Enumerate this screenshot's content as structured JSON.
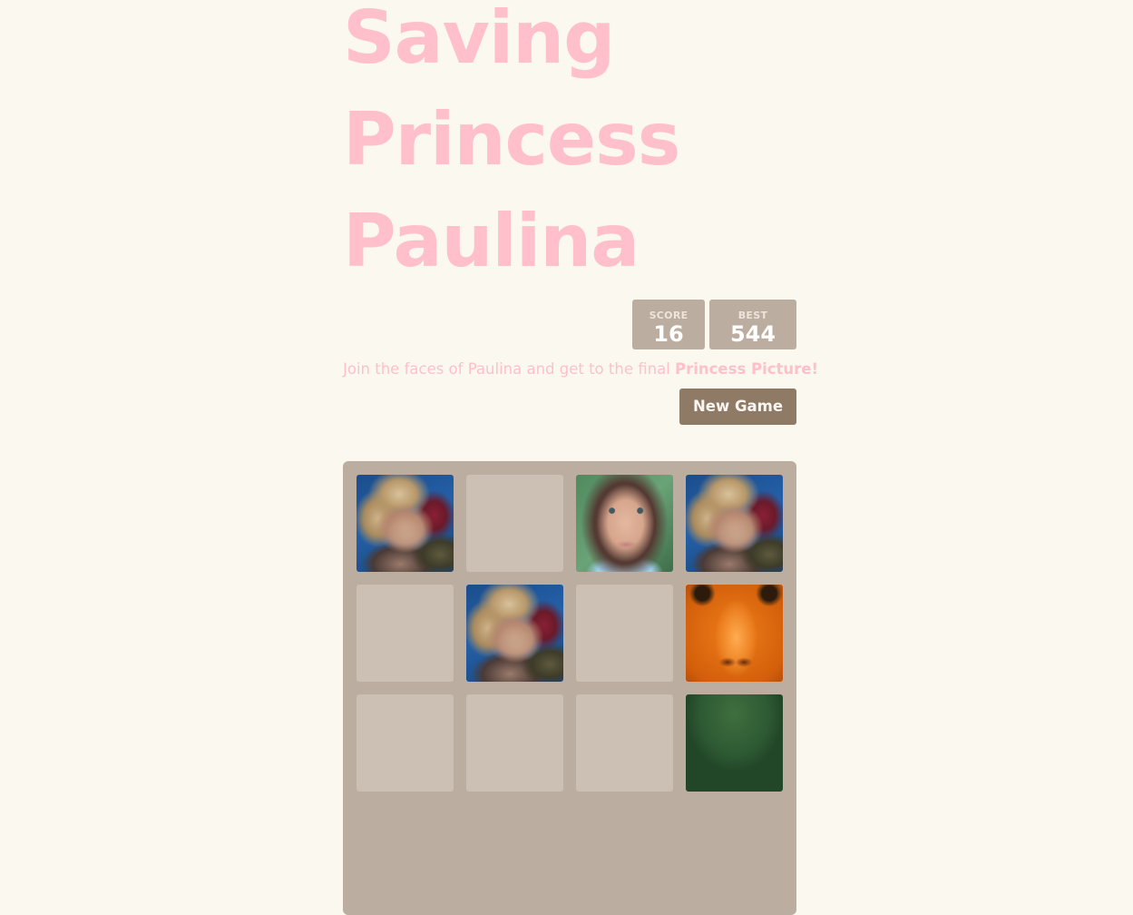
{
  "title": {
    "line1": "Saving",
    "line2": "Princess",
    "line3": "Paulina"
  },
  "scores": {
    "score_label": "SCORE",
    "score_value": "16",
    "best_label": "BEST",
    "best_value": "544"
  },
  "intro": {
    "text": "Join the faces of Paulina and get to the final ",
    "highlight": "Princess Picture!"
  },
  "new_game_label": "New Game",
  "board": {
    "rows": [
      [
        "face-a",
        "empty",
        "face-b",
        "face-a"
      ],
      [
        "empty",
        "face-a",
        "empty",
        "face-c"
      ],
      [
        "empty",
        "empty",
        "empty",
        "face-d"
      ]
    ]
  },
  "colors": {
    "background": "#faf8ef",
    "title": "#ffc0cb",
    "board": "#bbada0",
    "button": "#8f7a66"
  }
}
